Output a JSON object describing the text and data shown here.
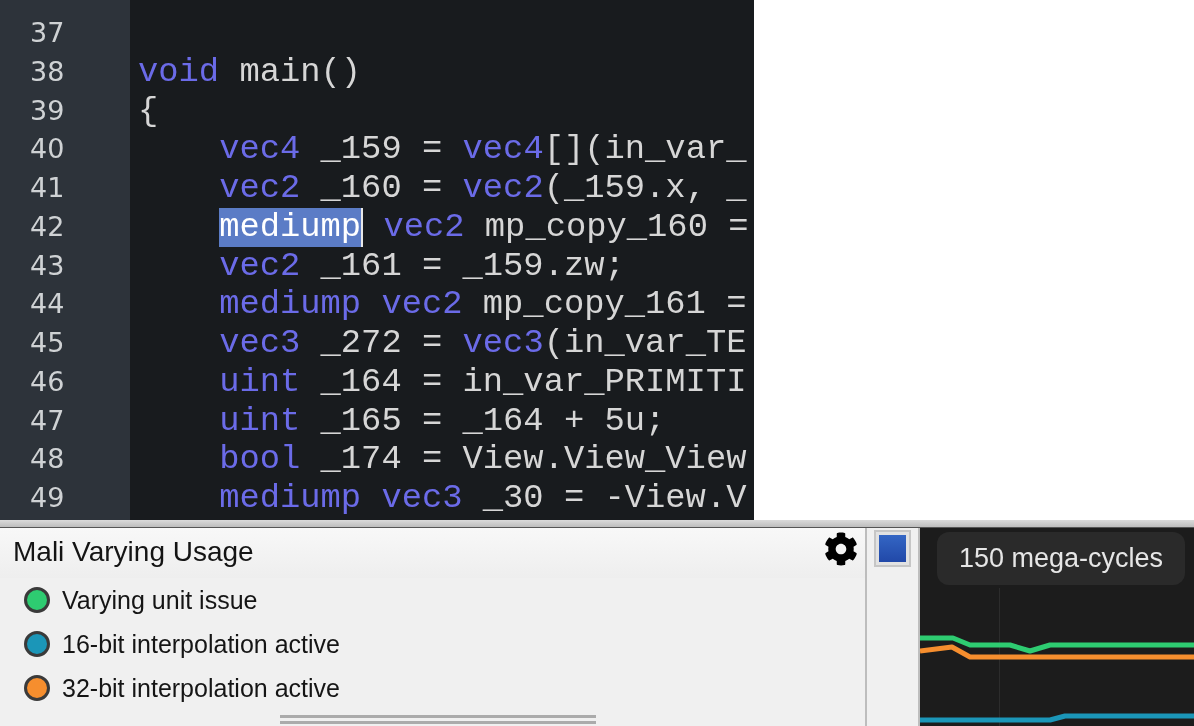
{
  "editor": {
    "lines": [
      {
        "number": "37"
      },
      {
        "number": "38",
        "tokens": [
          {
            "text": "void",
            "kind": "keyword",
            "selected": false
          },
          {
            "text": " main()",
            "kind": "text",
            "selected": false
          }
        ]
      },
      {
        "number": "39",
        "tokens": [
          {
            "text": "{",
            "kind": "text",
            "selected": false
          }
        ],
        "children": [
          {
            "number": "40",
            "tokens": [
              {
                "text": "vec4",
                "kind": "keyword",
                "selected": false
              },
              {
                "text": " _159 = ",
                "kind": "text",
                "selected": false
              },
              {
                "text": "vec4",
                "kind": "keyword",
                "selected": false
              },
              {
                "text": "[](in_var_",
                "kind": "text",
                "selected": false
              }
            ]
          },
          {
            "number": "41",
            "tokens": [
              {
                "text": "vec2",
                "kind": "keyword",
                "selected": false
              },
              {
                "text": " _160 = ",
                "kind": "text",
                "selected": false
              },
              {
                "text": "vec2",
                "kind": "keyword",
                "selected": false
              },
              {
                "text": "(_159.x, _",
                "kind": "text",
                "selected": false
              }
            ]
          },
          {
            "number": "42",
            "tokens": [
              {
                "text": "mediump",
                "kind": "keyword",
                "selected": true
              },
              {
                "text": " vec2",
                "kind": "keyword",
                "selected": false
              },
              {
                "text": " mp_copy_160 =",
                "kind": "text",
                "selected": false
              }
            ]
          },
          {
            "number": "43",
            "tokens": [
              {
                "text": "vec2",
                "kind": "keyword",
                "selected": false
              },
              {
                "text": " _161 = _159.zw;",
                "kind": "text",
                "selected": false
              }
            ]
          },
          {
            "number": "44",
            "tokens": [
              {
                "text": "mediump vec2",
                "kind": "keyword",
                "selected": false
              },
              {
                "text": " mp_copy_161 =",
                "kind": "text",
                "selected": false
              }
            ]
          },
          {
            "number": "45",
            "tokens": [
              {
                "text": "vec3",
                "kind": "keyword",
                "selected": false
              },
              {
                "text": " _272 = ",
                "kind": "text",
                "selected": false
              },
              {
                "text": "vec3",
                "kind": "keyword",
                "selected": false
              },
              {
                "text": "(in_var_TE",
                "kind": "text",
                "selected": false
              }
            ]
          },
          {
            "number": "46",
            "tokens": [
              {
                "text": "uint",
                "kind": "keyword",
                "selected": false
              },
              {
                "text": " _164 = in_var_PRIMITI",
                "kind": "text",
                "selected": false
              }
            ]
          },
          {
            "number": "47",
            "tokens": [
              {
                "text": "uint",
                "kind": "keyword",
                "selected": false
              },
              {
                "text": " _165 = _164 + 5u;",
                "kind": "text",
                "selected": false
              }
            ]
          },
          {
            "number": "48",
            "tokens": [
              {
                "text": "bool",
                "kind": "keyword",
                "selected": false
              },
              {
                "text": " _174 = View.View_View",
                "kind": "text",
                "selected": false
              }
            ]
          },
          {
            "number": "49",
            "tokens": [
              {
                "text": "mediump vec3",
                "kind": "keyword",
                "selected": false
              },
              {
                "text": " _30 = -View.V",
                "kind": "text",
                "selected": false
              }
            ]
          }
        ]
      }
    ]
  },
  "varying_panel": {
    "title": "Mali Varying Usage",
    "legend": [
      {
        "label": "Varying unit issue",
        "color": "#2ecc71"
      },
      {
        "label": "16-bit interpolation active",
        "color": "#1b96b8"
      },
      {
        "label": "32-bit interpolation active",
        "color": "#f68e2e"
      }
    ]
  },
  "chart_panel": {
    "scale_label": "150 mega-cycles"
  }
}
